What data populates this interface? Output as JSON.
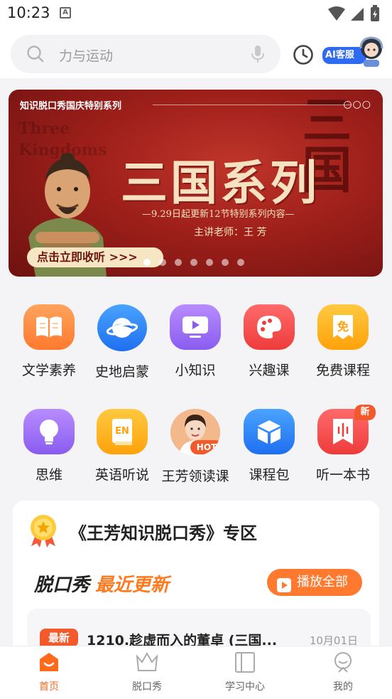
{
  "status_bar": {
    "time": "10:23",
    "notif_letter": "A"
  },
  "search": {
    "placeholder": "力与运动"
  },
  "ai_service": {
    "label": "AI客服"
  },
  "banner": {
    "series_label": "知识脱口秀国庆特别系列",
    "bg_english": "Three Kingdoms",
    "title": "三国系列",
    "subtitle": "—9.29日起更新12节特别系列内容—",
    "teacher": "主讲老师：王 芳",
    "cta": "点击立即收听 >>>",
    "page_count": 7,
    "active_page": 0
  },
  "grid": [
    {
      "label": "文学素养",
      "icon": "book-icon",
      "color": "#ff8a3d"
    },
    {
      "label": "史地启蒙",
      "icon": "planet-icon",
      "color": "#2f86f6"
    },
    {
      "label": "小知识",
      "icon": "video-icon",
      "color": "#9b6cf3"
    },
    {
      "label": "兴趣课",
      "icon": "palette-icon",
      "color": "#f44d4d"
    },
    {
      "label": "免费课程",
      "icon": "free-ticket-icon",
      "color": "#ffae1a"
    },
    {
      "label": "思维",
      "icon": "lightbulb-icon",
      "color": "#a069f3"
    },
    {
      "label": "英语听说",
      "icon": "english-book-icon",
      "color": "#ffab1f"
    },
    {
      "label": "王芳领读课",
      "icon": "teacher-avatar-icon",
      "color": "#f8c9a0",
      "badge": "HOT"
    },
    {
      "label": "课程包",
      "icon": "package-box-icon",
      "color": "#2f86f6"
    },
    {
      "label": "听一本书",
      "icon": "audio-book-icon",
      "color": "#f44d4d",
      "badge": "新"
    }
  ],
  "zone": {
    "title": "《王芳知识脱口秀》专区",
    "tag_a": "脱口秀",
    "tag_b": "最近更新",
    "play_all": "播放全部",
    "latest": {
      "badge": "最新",
      "title": "1210.趁虚而入的董卓 (三国...",
      "date": "10月01日"
    }
  },
  "nav": [
    {
      "label": "首页",
      "icon": "home-icon",
      "active": true
    },
    {
      "label": "脱口秀",
      "icon": "crown-icon",
      "active": false
    },
    {
      "label": "学习中心",
      "icon": "study-book-icon",
      "active": false
    },
    {
      "label": "我的",
      "icon": "profile-icon",
      "active": false
    }
  ],
  "colors": {
    "accent": "#ff6a1c",
    "badge": "#f35a2b",
    "ai_blue": "#2f6bf2",
    "banner_red": "#9e1f1a"
  }
}
